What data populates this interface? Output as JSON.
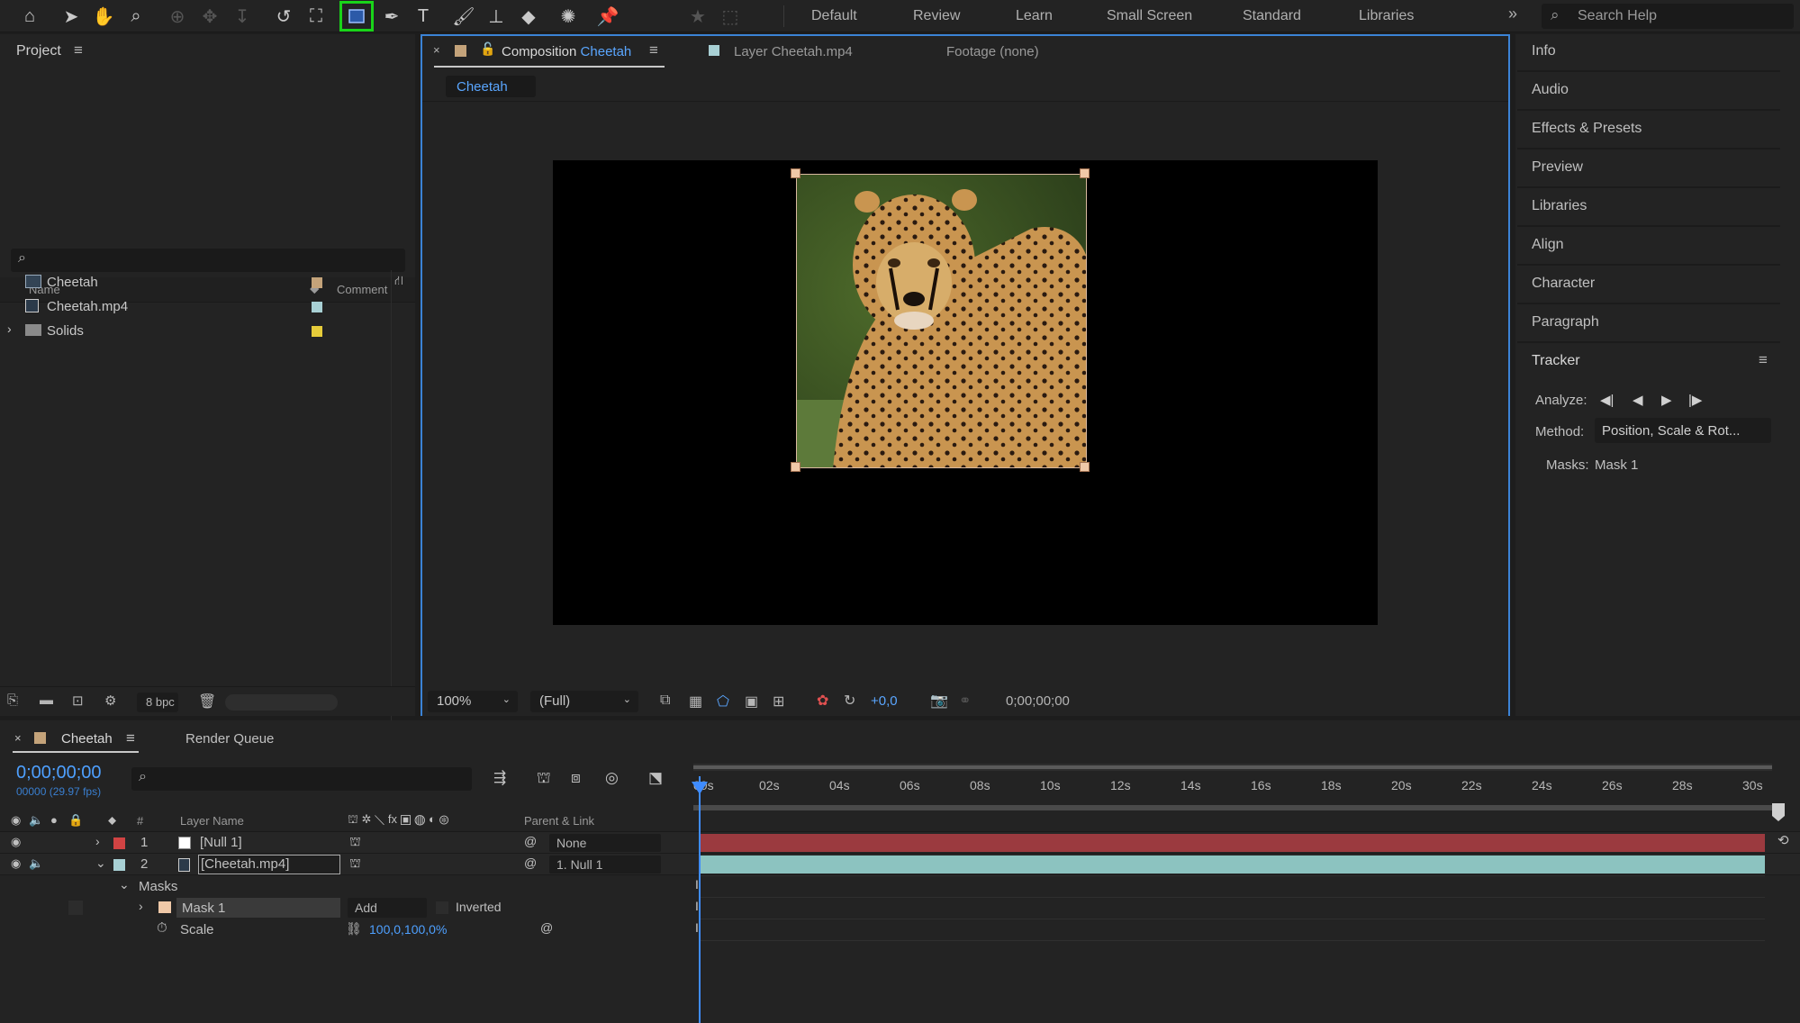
{
  "workspaces": [
    "Default",
    "Review",
    "Learn",
    "Small Screen",
    "Standard",
    "Libraries"
  ],
  "search_help": {
    "placeholder": "Search Help"
  },
  "project": {
    "title": "Project",
    "columns": {
      "name": "Name",
      "comment": "Comment"
    },
    "items": [
      {
        "label": "Cheetah",
        "color": "#c4a37a"
      },
      {
        "label": "Cheetah.mp4",
        "color": "#a8d0d4"
      },
      {
        "label": "Solids",
        "color": "#e6cc3a"
      }
    ],
    "bpc": "8 bpc"
  },
  "comp": {
    "tab_prefix": "Composition",
    "tab_name": "Cheetah",
    "layer_tab": "Layer Cheetah.mp4",
    "footage_tab": "Footage (none)",
    "breadcrumb": "Cheetah",
    "zoom": "100%",
    "resolution": "(Full)",
    "exposure": "+0,0",
    "timecode": "0;00;00;00"
  },
  "right_panels": [
    "Info",
    "Audio",
    "Effects & Presets",
    "Preview",
    "Libraries",
    "Align",
    "Character",
    "Paragraph"
  ],
  "tracker": {
    "title": "Tracker",
    "analyze_label": "Analyze:",
    "method_label": "Method:",
    "method_value": "Position, Scale & Rot...",
    "masks_label": "Masks:",
    "masks_value": "Mask 1"
  },
  "timeline": {
    "tab": "Cheetah",
    "render_queue": "Render Queue",
    "timecode": "0;00;00;00",
    "frame_info": "00000 (29.97 fps)",
    "col_num": "#",
    "col_layer": "Layer Name",
    "col_parent": "Parent & Link",
    "ruler": [
      "00s",
      "02s",
      "04s",
      "06s",
      "08s",
      "10s",
      "12s",
      "14s",
      "16s",
      "18s",
      "20s",
      "22s",
      "24s",
      "26s",
      "28s",
      "30s"
    ],
    "layers": [
      {
        "num": "1",
        "name": "[Null 1]",
        "color": "#d14343",
        "parent": "None"
      },
      {
        "num": "2",
        "name": "[Cheetah.mp4]",
        "color": "#a8d0d4",
        "parent": "1. Null 1"
      }
    ],
    "masks_group": "Masks",
    "mask_name": "Mask 1",
    "mask_mode": "Add",
    "inverted": "Inverted",
    "scale_label": "Scale",
    "scale_value": "100,0,100,0%",
    "bar_colors": {
      "null": "#9b3a3f",
      "footage": "#8cc3c0"
    }
  }
}
